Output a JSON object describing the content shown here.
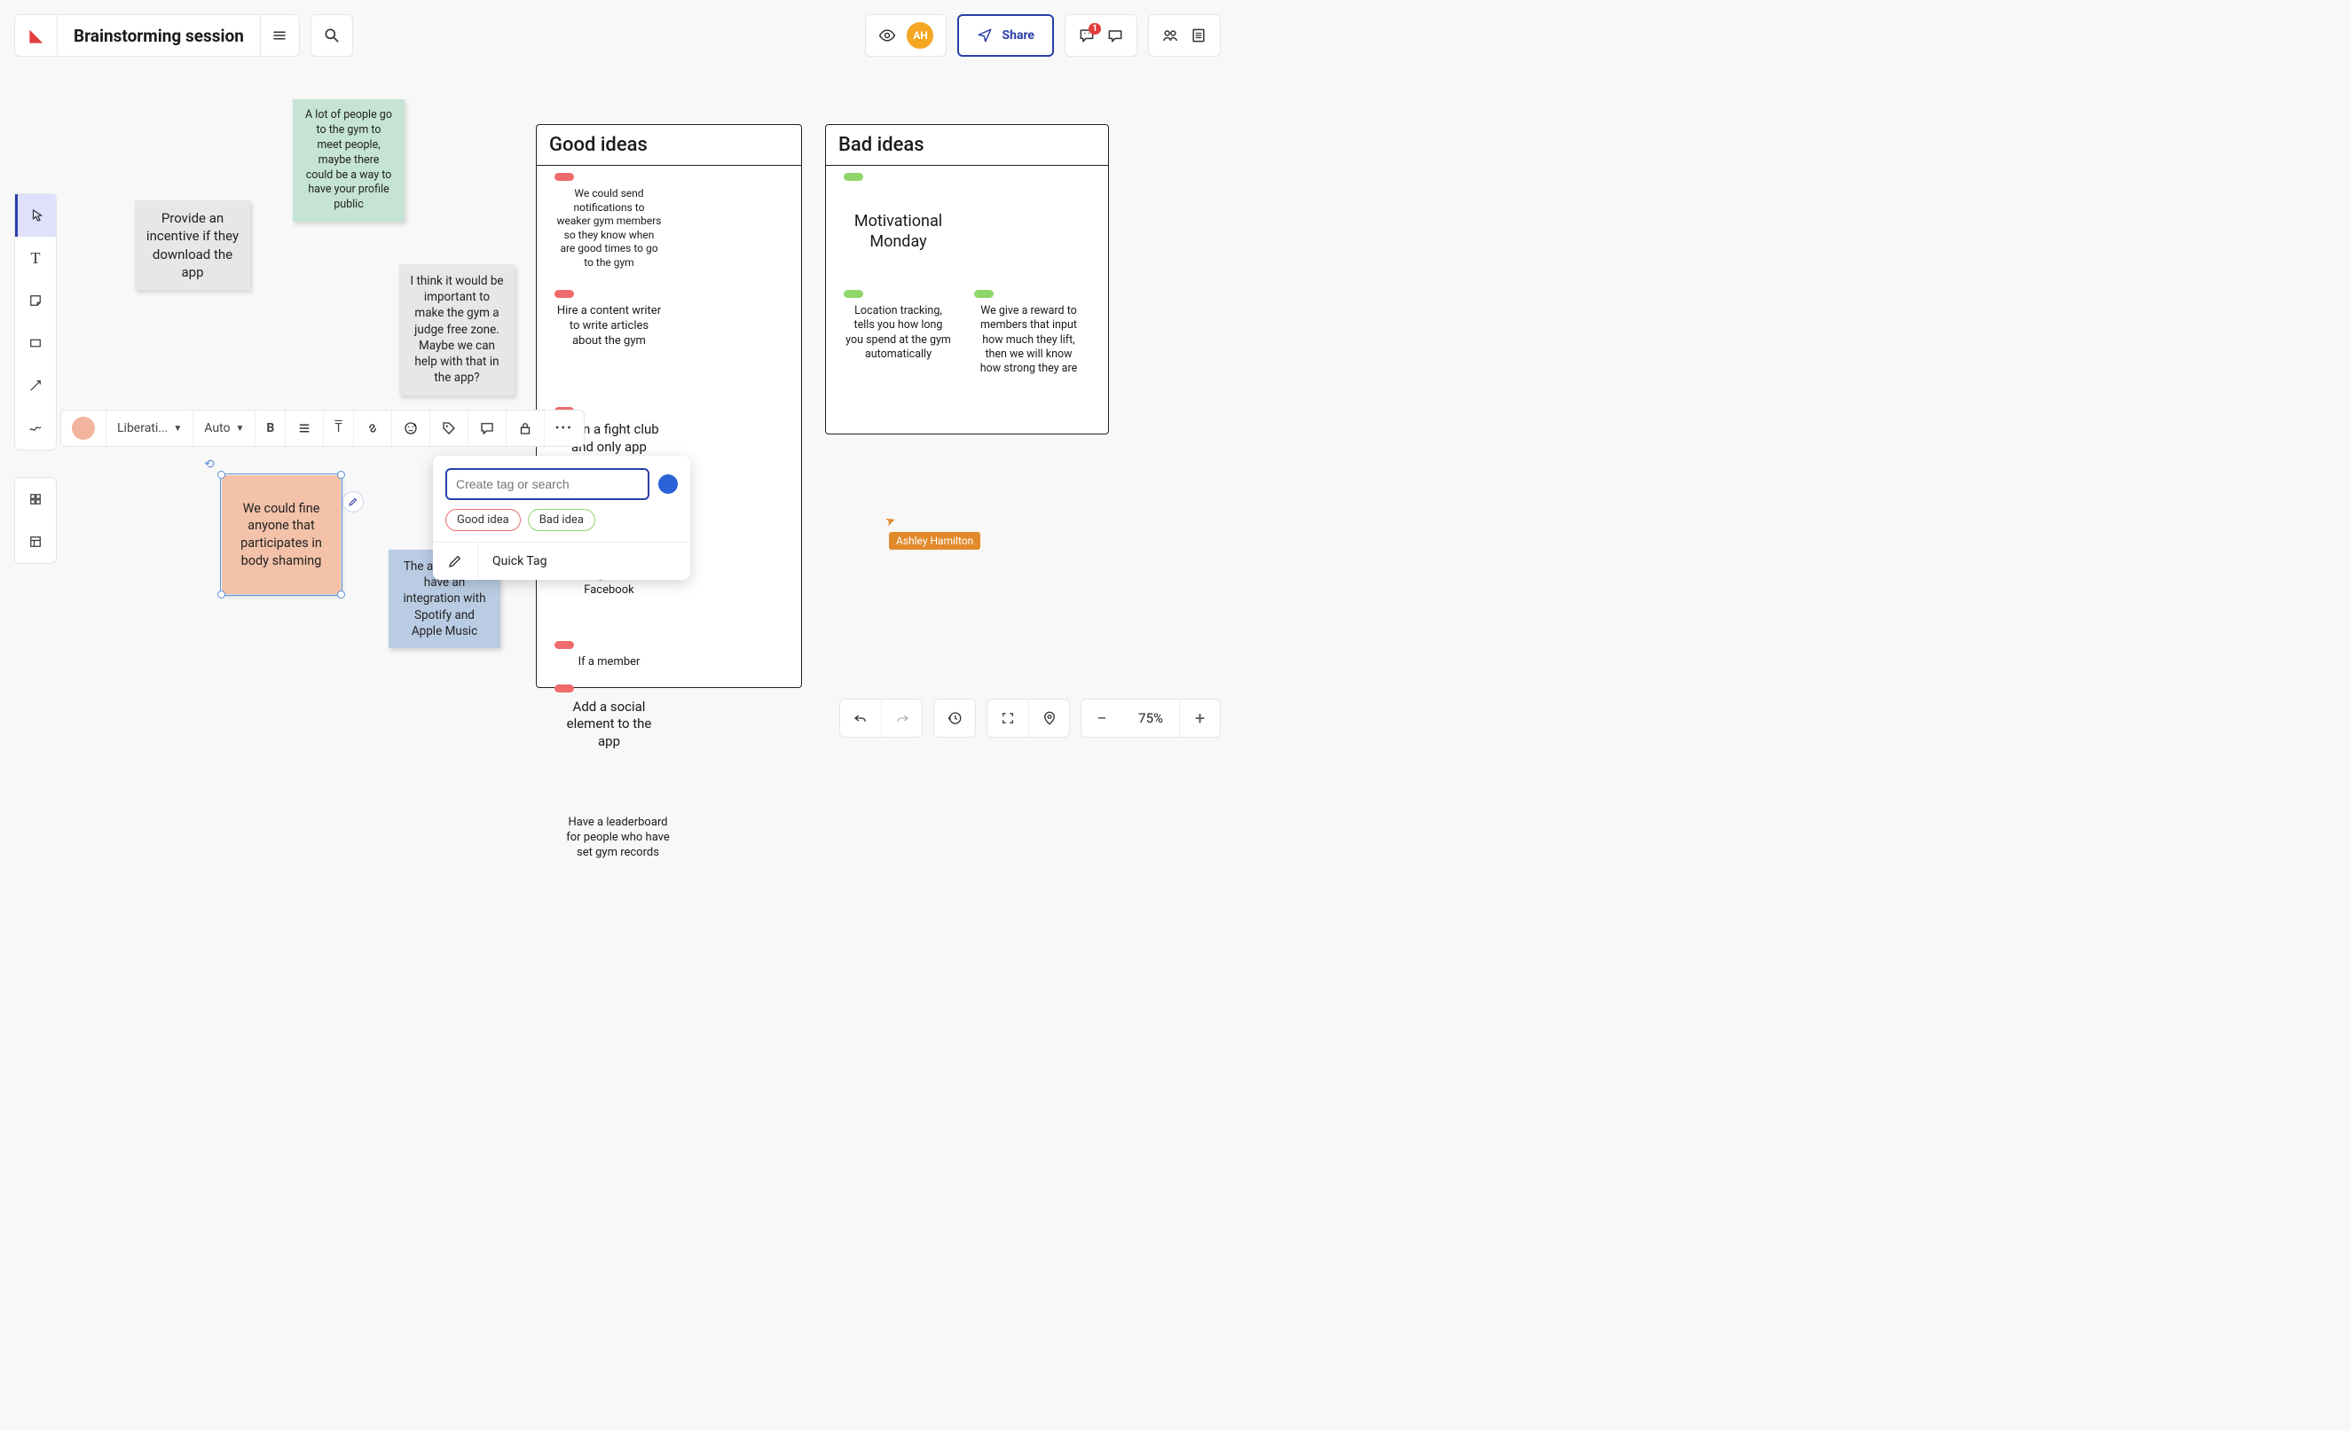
{
  "header": {
    "title": "Brainstorming session",
    "avatar_initials": "AH",
    "share_label": "Share",
    "comment_badge": "1"
  },
  "notes": {
    "incentive": "Provide an incentive if they download the app",
    "profile_public": "A lot of people go to the gym to meet people, maybe there could be a way to have your profile public",
    "judge_free": "I think it would be important to make the gym a judge free zone. Maybe we can help with that in the app?",
    "fine_body_shaming": "We could fine anyone that participates in body shaming",
    "spotify": "The app should have an integration with Spotify and Apple Music"
  },
  "columns": {
    "good": {
      "title": "Good ideas",
      "items": [
        "We could send notifications to weaker gym members so they know when are good times to go to the gym",
        "Hire a content writer to write articles about the gym",
        "Open a fight club and only app users get in",
        "Users can post comments/like on Instagram and Facebook",
        "If a member",
        "Add a social element to the app",
        "Have a leaderboard for people who have set gym records"
      ]
    },
    "bad": {
      "title": "Bad ideas",
      "items": [
        "Motivational Monday",
        "Location tracking, tells you how long you spend at the gym automatically",
        "We give a reward to members that input how much they lift, then we will know how strong they are"
      ]
    }
  },
  "format_toolbar": {
    "font": "Liberati...",
    "size": "Auto"
  },
  "tag_popup": {
    "placeholder": "Create tag or search",
    "chips": [
      "Good idea",
      "Bad idea"
    ],
    "quick_tag": "Quick Tag"
  },
  "cursor": {
    "name": "Ashley Hamilton"
  },
  "bottom": {
    "zoom": "75%"
  }
}
